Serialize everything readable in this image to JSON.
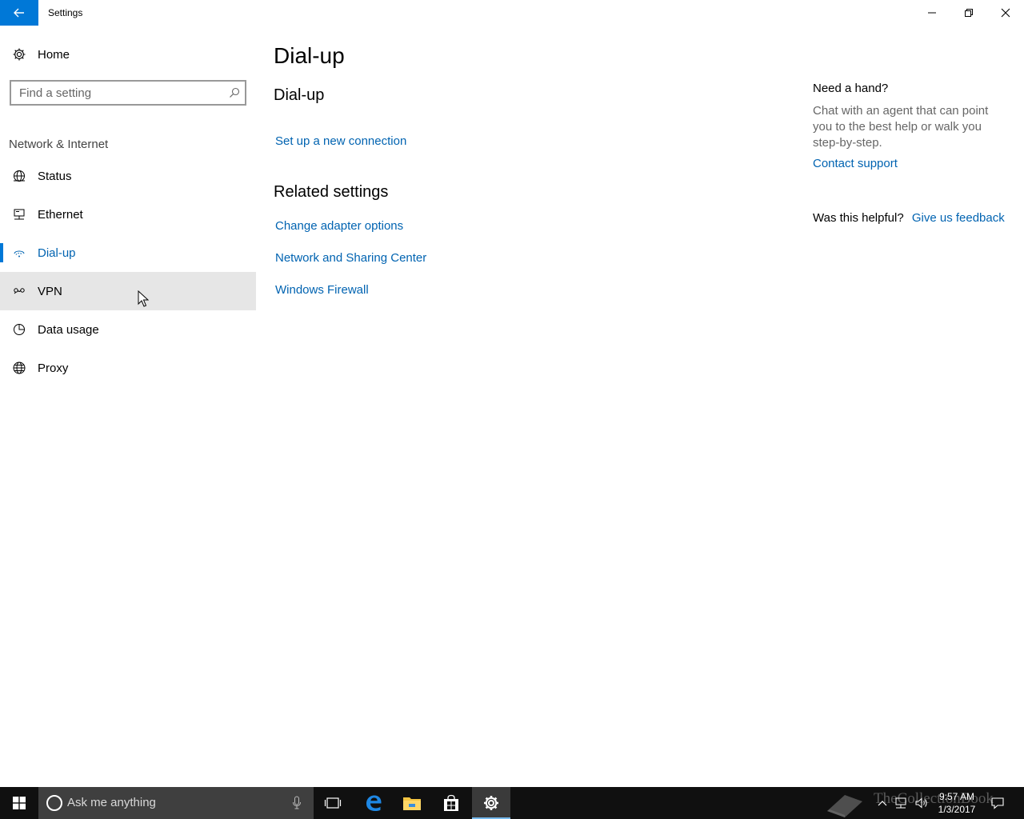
{
  "window": {
    "title": "Settings",
    "accent": "#0078d7"
  },
  "sidebar": {
    "home_label": "Home",
    "search_placeholder": "Find a setting",
    "section_header": "Network & Internet",
    "items": [
      {
        "label": "Status",
        "icon": "globe-status-icon"
      },
      {
        "label": "Ethernet",
        "icon": "ethernet-icon"
      },
      {
        "label": "Dial-up",
        "icon": "dial-up-icon",
        "selected": true
      },
      {
        "label": "VPN",
        "icon": "vpn-icon",
        "hovered": true
      },
      {
        "label": "Data usage",
        "icon": "data-usage-icon"
      },
      {
        "label": "Proxy",
        "icon": "globe-icon"
      }
    ]
  },
  "main": {
    "page_title": "Dial-up",
    "section_title": "Dial-up",
    "setup_link": "Set up a new connection",
    "related_title": "Related settings",
    "related_links": [
      "Change adapter options",
      "Network and Sharing Center",
      "Windows Firewall"
    ],
    "link_color": "#0063b1"
  },
  "help": {
    "title": "Need a hand?",
    "text": "Chat with an agent that can point you to the best help or walk you step-by-step.",
    "contact_link": "Contact support",
    "helpful_question": "Was this helpful?",
    "feedback_link": "Give us feedback"
  },
  "taskbar": {
    "search_placeholder": "Ask me anything",
    "time": "9:57 AM",
    "date": "1/3/2017",
    "watermark": "TheCollectionBook"
  }
}
